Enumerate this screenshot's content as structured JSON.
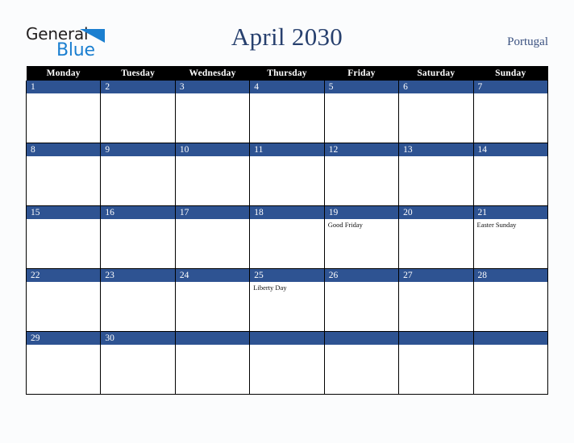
{
  "brand": {
    "name_part1": "General",
    "name_part2": "Blue",
    "triangle_icon": "triangle-icon",
    "accent_color": "#1b7fd0"
  },
  "header": {
    "title": "April 2030",
    "region": "Portugal"
  },
  "colors": {
    "header_row_bg": "#000000",
    "day_band_bg": "#2e5392",
    "title_text": "#27406e",
    "page_bg": "#fbfcfd"
  },
  "calendar": {
    "weekday_headers": [
      "Monday",
      "Tuesday",
      "Wednesday",
      "Thursday",
      "Friday",
      "Saturday",
      "Sunday"
    ],
    "weeks": [
      [
        {
          "day": "1",
          "events": []
        },
        {
          "day": "2",
          "events": []
        },
        {
          "day": "3",
          "events": []
        },
        {
          "day": "4",
          "events": []
        },
        {
          "day": "5",
          "events": []
        },
        {
          "day": "6",
          "events": []
        },
        {
          "day": "7",
          "events": []
        }
      ],
      [
        {
          "day": "8",
          "events": []
        },
        {
          "day": "9",
          "events": []
        },
        {
          "day": "10",
          "events": []
        },
        {
          "day": "11",
          "events": []
        },
        {
          "day": "12",
          "events": []
        },
        {
          "day": "13",
          "events": []
        },
        {
          "day": "14",
          "events": []
        }
      ],
      [
        {
          "day": "15",
          "events": []
        },
        {
          "day": "16",
          "events": []
        },
        {
          "day": "17",
          "events": []
        },
        {
          "day": "18",
          "events": []
        },
        {
          "day": "19",
          "events": [
            "Good Friday"
          ]
        },
        {
          "day": "20",
          "events": []
        },
        {
          "day": "21",
          "events": [
            "Easter Sunday"
          ]
        }
      ],
      [
        {
          "day": "22",
          "events": []
        },
        {
          "day": "23",
          "events": []
        },
        {
          "day": "24",
          "events": []
        },
        {
          "day": "25",
          "events": [
            "Liberty Day"
          ]
        },
        {
          "day": "26",
          "events": []
        },
        {
          "day": "27",
          "events": []
        },
        {
          "day": "28",
          "events": []
        }
      ],
      [
        {
          "day": "29",
          "events": []
        },
        {
          "day": "30",
          "events": []
        },
        {
          "day": "",
          "events": []
        },
        {
          "day": "",
          "events": []
        },
        {
          "day": "",
          "events": []
        },
        {
          "day": "",
          "events": []
        },
        {
          "day": "",
          "events": []
        }
      ]
    ]
  }
}
